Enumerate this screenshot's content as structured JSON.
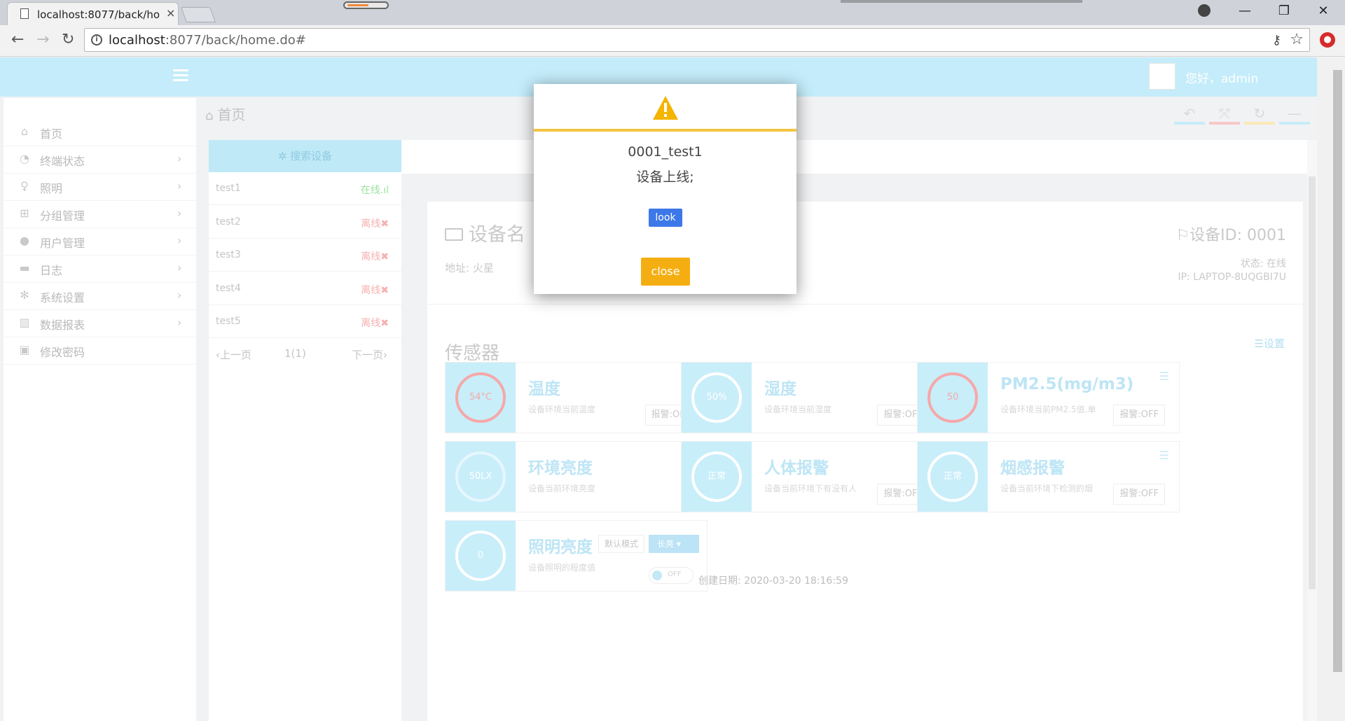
{
  "browser": {
    "tab_title": "localhost:8077/back/ho",
    "tab_close": "×",
    "url_host": "localhost",
    "url_path": ":8077/back/home.do#",
    "win_min": "—",
    "win_max": "❐",
    "win_close": "✕"
  },
  "header": {
    "greeting": "您好，admin"
  },
  "sidebar": {
    "items": [
      {
        "label": "首页",
        "icon": "home-icon",
        "glyph": "⌂",
        "has_arrow": false
      },
      {
        "label": "终端状态",
        "icon": "dashboard-icon",
        "glyph": "◔",
        "has_arrow": true
      },
      {
        "label": "照明",
        "icon": "lightbulb-icon",
        "glyph": "♀",
        "has_arrow": true
      },
      {
        "label": "分组管理",
        "icon": "sitemap-icon",
        "glyph": "⊞",
        "has_arrow": true
      },
      {
        "label": "用户管理",
        "icon": "user-icon",
        "glyph": "●",
        "has_arrow": true
      },
      {
        "label": "日志",
        "icon": "archive-icon",
        "glyph": "▬",
        "has_arrow": true
      },
      {
        "label": "系统设置",
        "icon": "cogs-icon",
        "glyph": "✻",
        "has_arrow": true
      },
      {
        "label": "数据报表",
        "icon": "bar-chart-icon",
        "glyph": "▥",
        "has_arrow": true
      },
      {
        "label": "修改密码",
        "icon": "lock-icon",
        "glyph": "▣",
        "has_arrow": false
      }
    ],
    "arrow": "›"
  },
  "breadcrumb": {
    "label": "首页"
  },
  "device_list": {
    "search_label": "✲ 搜索设备",
    "devices": [
      {
        "name": "test1",
        "status": "在线",
        "online": true
      },
      {
        "name": "test2",
        "status": "离线",
        "online": false
      },
      {
        "name": "test3",
        "status": "离线",
        "online": false
      },
      {
        "name": "test4",
        "status": "离线",
        "online": false
      },
      {
        "name": "test5",
        "status": "离线",
        "online": false
      }
    ],
    "pager": {
      "prev": "‹上一页",
      "page": "1(1)",
      "next": "下一页›"
    }
  },
  "device": {
    "title": "设备名",
    "address": "地址: 火星",
    "id_label": "设备ID:  0001",
    "state": "状态: 在线",
    "ip": "IP: LAPTOP-8UQGBI7U",
    "created": "创建日期: 2020-03-20 18:16:59"
  },
  "sensors": {
    "heading": "传感器",
    "settings_label": "☰设置",
    "cards": [
      {
        "value": "54°C",
        "title": "温度",
        "desc": "设备环境当前温度",
        "btn": "报警:ON",
        "ring_color": "#f6a8a8"
      },
      {
        "value": "50%",
        "title": "湿度",
        "desc": "设备环境当前湿度",
        "btn": "报警:OFF",
        "ring_color": "#ffffff"
      },
      {
        "value": "50",
        "title": "PM2.5(mg/m3)",
        "desc": "设备环境当前PM2.5值,单",
        "btn": "报警:OFF",
        "ring_color": "#f6a8a8"
      },
      {
        "value": "50LX",
        "title": "环境亮度",
        "desc": "设备当前环境亮度",
        "btn": "",
        "ring_color": "#e6f7fd"
      },
      {
        "value": "正常",
        "title": "人体报警",
        "desc": "设备当前环境下有没有人",
        "btn": "报警:OFF",
        "ring_color": "#ffffff"
      },
      {
        "value": "正常",
        "title": "烟感报警",
        "desc": "设备当前环境下检测的烟",
        "btn": "报警:OFF",
        "ring_color": "#ffffff"
      },
      {
        "value": "0",
        "title": "照明亮度",
        "desc": "设备照明的程度值",
        "btn": "",
        "ring_color": "#ffffff"
      }
    ],
    "lighting": {
      "mode_label": "默认模式",
      "select_label": "长亮 ▾",
      "toggle_label": "OFF"
    }
  },
  "modal": {
    "line1": "0001_test1",
    "line2": "设备上线;",
    "look_label": "look",
    "close_label": "close",
    "accent": "#f4c542"
  }
}
